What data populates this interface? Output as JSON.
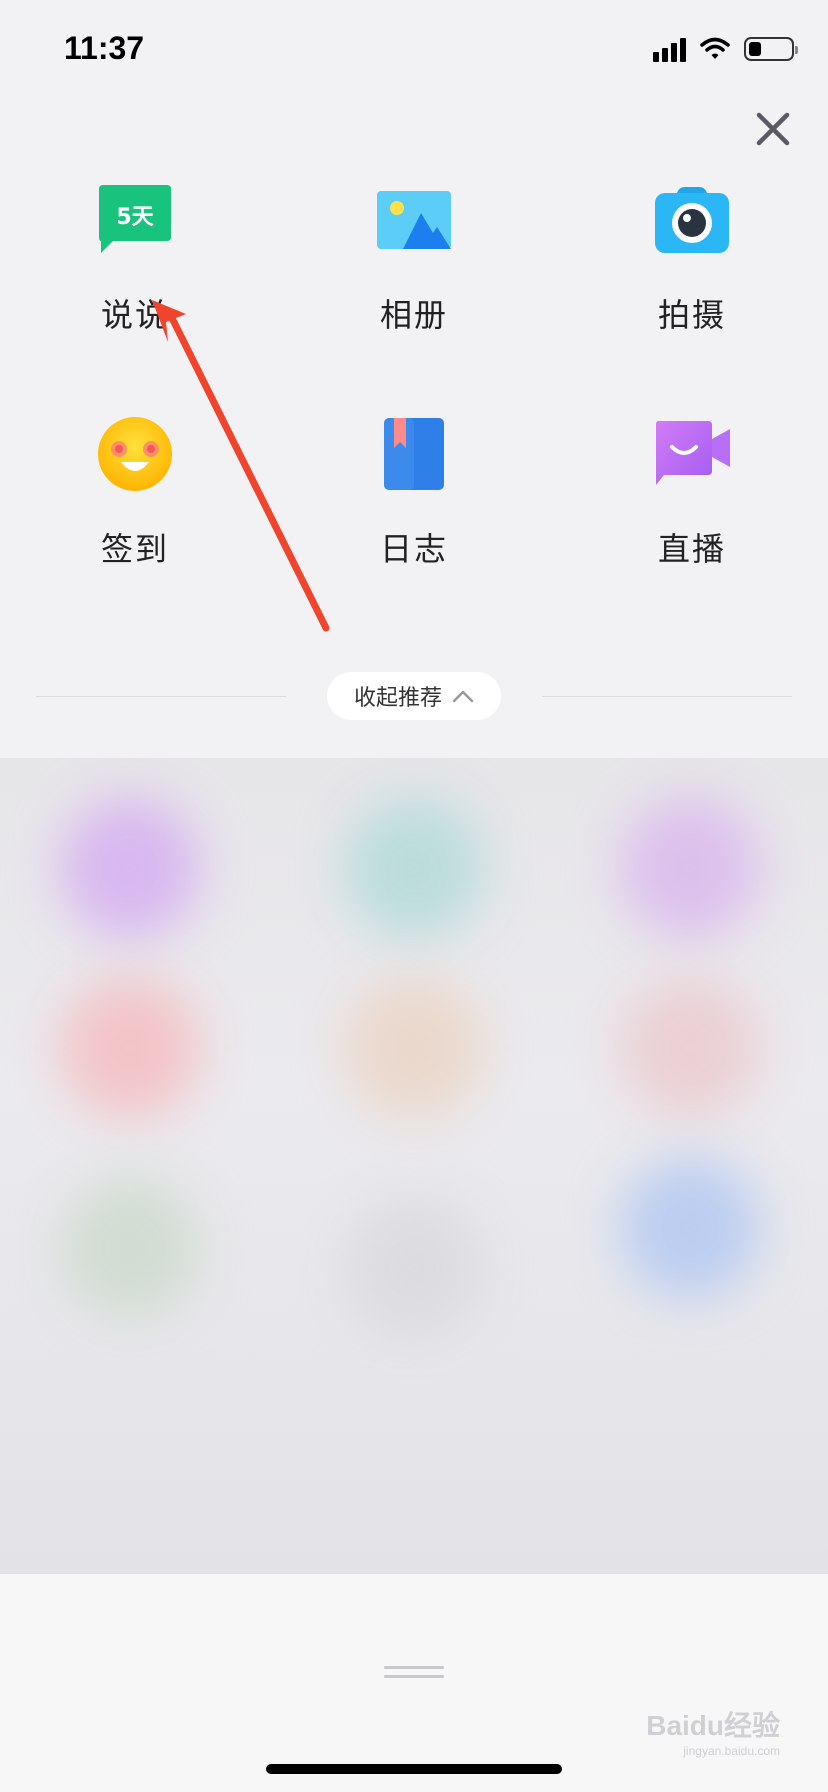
{
  "status_bar": {
    "time": "11:37"
  },
  "tiles": [
    {
      "label": "说说",
      "badge": "5天",
      "icon": "shuoshuo-icon",
      "color": "#19c37d"
    },
    {
      "label": "相册",
      "icon": "album-icon",
      "color": "#39b8f2"
    },
    {
      "label": "拍摄",
      "icon": "camera-icon",
      "color": "#2bb6f5"
    },
    {
      "label": "签到",
      "icon": "checkin-smiley-icon",
      "color": "#ffc21a"
    },
    {
      "label": "日志",
      "icon": "diary-icon",
      "color": "#2f7fe8"
    },
    {
      "label": "直播",
      "icon": "live-video-icon",
      "color": "#b86df5"
    }
  ],
  "collapse_button": {
    "label": "收起推荐"
  },
  "watermark": {
    "text": "Baidu经验",
    "sub": "jingyan.baidu.com"
  },
  "annotation": {
    "arrow_color": "#f0442c"
  }
}
